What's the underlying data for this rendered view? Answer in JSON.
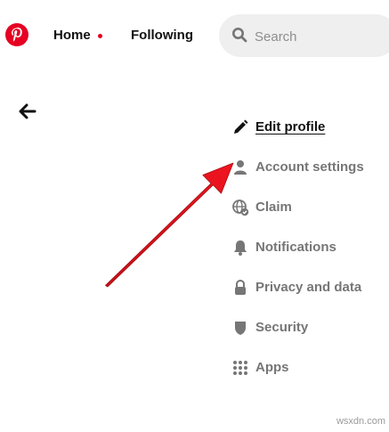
{
  "header": {
    "nav": {
      "home": "Home",
      "following": "Following"
    },
    "search": {
      "placeholder": "Search"
    }
  },
  "settings_menu": {
    "items": [
      {
        "label": "Edit profile",
        "icon": "pencil-icon",
        "active": true
      },
      {
        "label": "Account settings",
        "icon": "person-icon"
      },
      {
        "label": "Claim",
        "icon": "globe-check-icon"
      },
      {
        "label": "Notifications",
        "icon": "bell-icon"
      },
      {
        "label": "Privacy and data",
        "icon": "lock-icon"
      },
      {
        "label": "Security",
        "icon": "shield-icon"
      },
      {
        "label": "Apps",
        "icon": "grid-icon"
      }
    ]
  },
  "annotation": {
    "arrow_color": "#e8101d",
    "target": "Account settings"
  },
  "watermark": "wsxdn.com",
  "colors": {
    "brand": "#e60023",
    "muted_text": "#767676",
    "search_bg": "#efefef"
  }
}
